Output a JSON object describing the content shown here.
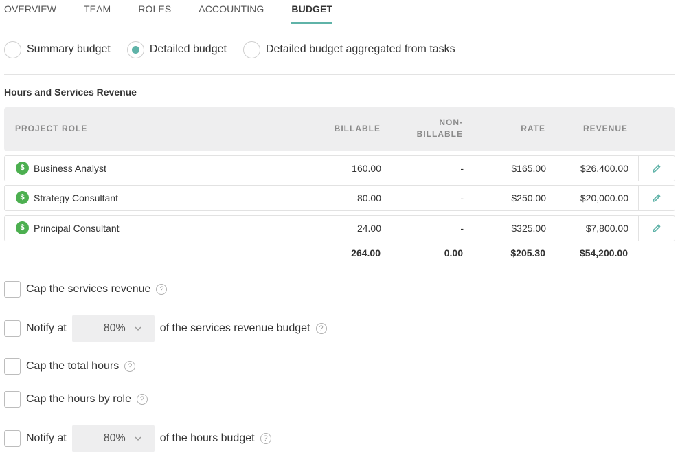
{
  "tabs": [
    {
      "label": "OVERVIEW"
    },
    {
      "label": "TEAM"
    },
    {
      "label": "ROLES"
    },
    {
      "label": "ACCOUNTING"
    },
    {
      "label": "BUDGET"
    }
  ],
  "active_tab": "BUDGET",
  "budget_types": [
    {
      "label": "Summary budget",
      "selected": false
    },
    {
      "label": "Detailed budget",
      "selected": true
    },
    {
      "label": "Detailed budget aggregated from tasks",
      "selected": false
    }
  ],
  "section_title": "Hours and Services Revenue",
  "table": {
    "headers": {
      "role": "PROJECT ROLE",
      "billable": "BILLABLE",
      "nonbillable_1": "NON-",
      "nonbillable_2": "BILLABLE",
      "rate": "RATE",
      "revenue": "REVENUE"
    },
    "rows": [
      {
        "icon": "$",
        "role": "Business Analyst",
        "billable": "160.00",
        "nonbillable": "-",
        "rate": "$165.00",
        "revenue": "$26,400.00"
      },
      {
        "icon": "$",
        "role": "Strategy Consultant",
        "billable": "80.00",
        "nonbillable": "-",
        "rate": "$250.00",
        "revenue": "$20,000.00"
      },
      {
        "icon": "$",
        "role": "Principal Consultant",
        "billable": "24.00",
        "nonbillable": "-",
        "rate": "$325.00",
        "revenue": "$7,800.00"
      }
    ],
    "totals": {
      "billable": "264.00",
      "nonbillable": "0.00",
      "rate": "$205.30",
      "revenue": "$54,200.00"
    }
  },
  "options": {
    "cap_revenue": {
      "label": "Cap the services revenue",
      "checked": false
    },
    "notify_revenue": {
      "prefix": "Notify at",
      "value": "80%",
      "suffix": "of the services revenue budget",
      "checked": false
    },
    "cap_hours": {
      "label": "Cap the total hours",
      "checked": false
    },
    "cap_hours_role": {
      "label": "Cap the hours by role",
      "checked": false
    },
    "notify_hours": {
      "prefix": "Notify at",
      "value": "80%",
      "suffix": "of the hours budget",
      "checked": false
    }
  },
  "help_glyph": "?",
  "colors": {
    "accent": "#5fb3a8",
    "money_icon": "#4caf50"
  }
}
